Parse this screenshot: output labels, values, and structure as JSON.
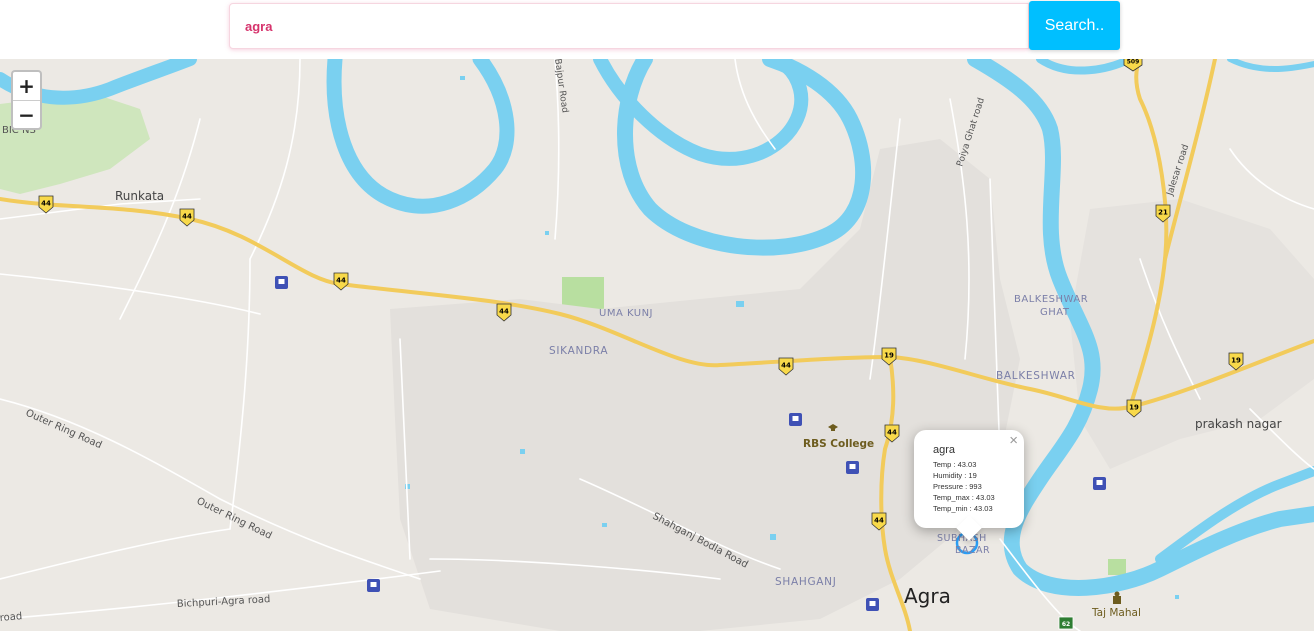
{
  "search": {
    "value": "agra",
    "button_label": "Search.."
  },
  "zoom": {
    "in_label": "+",
    "out_label": "−"
  },
  "map": {
    "place_labels": {
      "runkata": "Runkata",
      "uma_kunj": "UMA KUNJ",
      "sikandra": "SIKANDRA",
      "balkeshwar_ghat_1": "BALKESHWAR",
      "balkeshwar_ghat_2": "GHAT",
      "balkeshwar": "BALKESHWAR",
      "prakash_nagar": "prakash nagar",
      "rbs_college": "RBS College",
      "shahganj": "SHAHGANJ",
      "agra": "Agra",
      "taj_mahal": "Taj Mahal",
      "bichpuri": "Bichpuri-Agra road",
      "road_frag": "road",
      "outer_ring_1": "Outer Ring Road",
      "outer_ring_2": "Outer Ring Road",
      "shahganj_bodla": "Shahganj Bodla Road",
      "bajpur_road": "Bajpur Road",
      "poiya_ghat_road": "Poiya Ghat road",
      "jalesar_road": "Jalesar road",
      "bichpuri_frag": "BIC NS",
      "subhash_1": "SUBHASH",
      "subhash_2": "BAZAR"
    },
    "shields": {
      "s44_a": "44",
      "s44_b": "44",
      "s44_c": "44",
      "s44_d": "44",
      "s44_e": "44",
      "s44_f": "44",
      "s44_g": "44",
      "s19_a": "19",
      "s19_b": "19",
      "s19_c": "19",
      "s21": "21",
      "s509": "509",
      "s62": "62"
    }
  },
  "popup": {
    "city": "agra",
    "close": "×",
    "temp": "Temp : 43.03",
    "humidity": "Humidity : 19",
    "pressure": "Pressure : 993",
    "temp_max": "Temp_max : 43.03",
    "temp_min": "Temp_min : 43.03"
  },
  "colors": {
    "accent": "#00bfff",
    "search_text": "#d6336c",
    "water": "#7ad0f0",
    "highway": "#f2cb5b",
    "land": "#ece9e4",
    "park": "#bfe3a6"
  }
}
